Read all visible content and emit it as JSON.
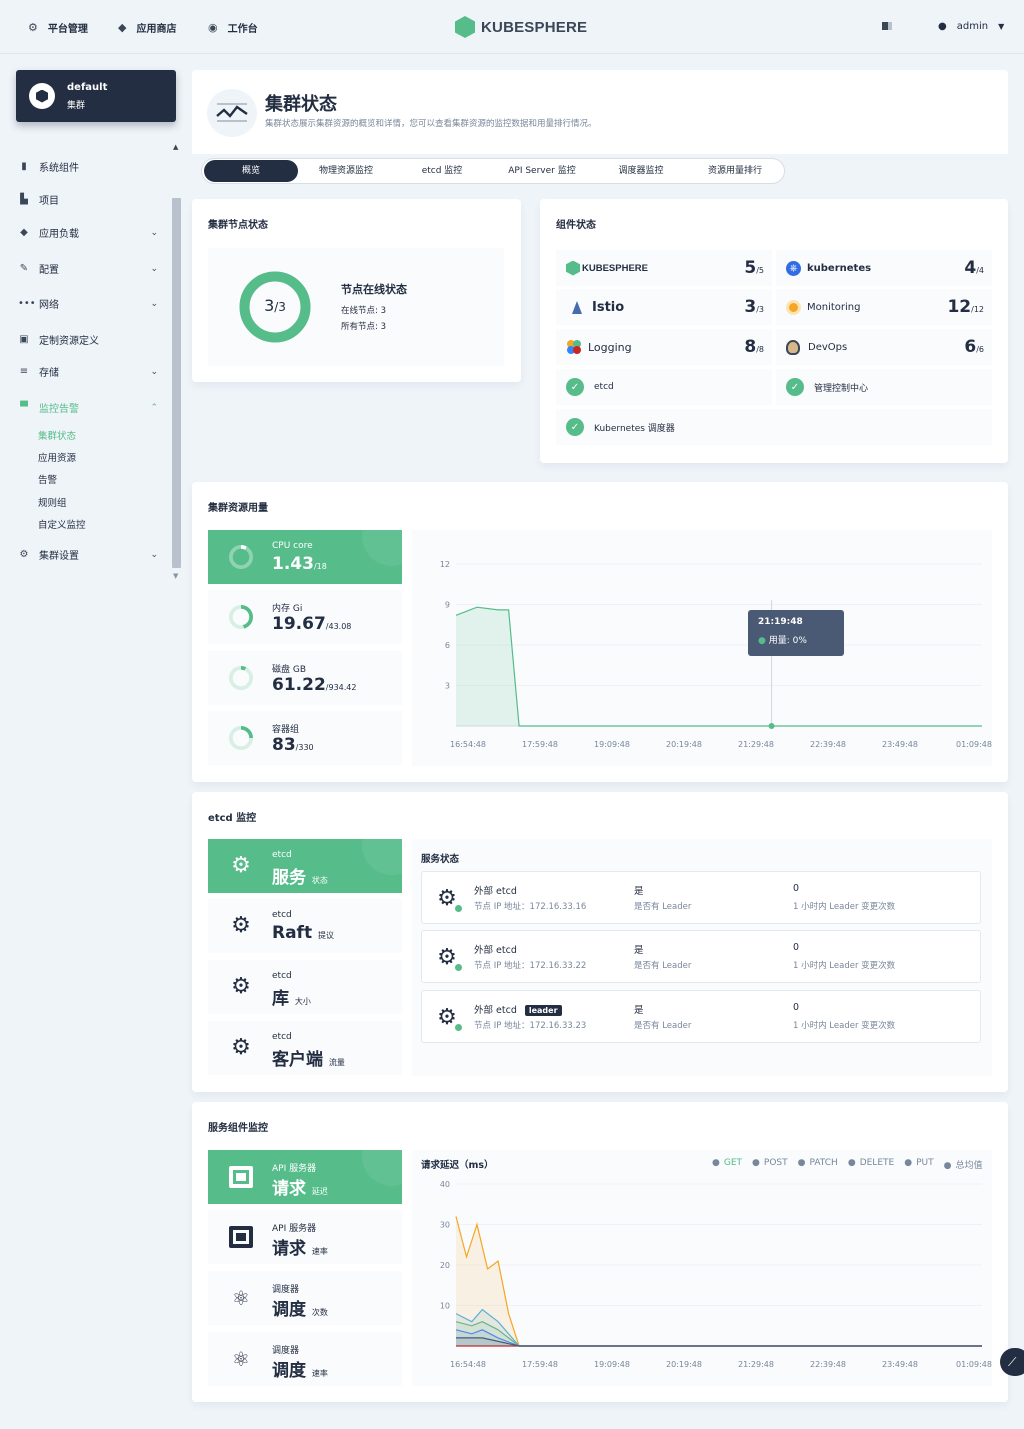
{
  "topbar": {
    "nav": [
      {
        "label": "平台管理",
        "icon": "gear-icon"
      },
      {
        "label": "应用商店",
        "icon": "app-store-icon"
      },
      {
        "label": "工作台",
        "icon": "workbench-icon"
      }
    ],
    "logo": "KUBESPHERE",
    "user": "admin"
  },
  "sidebar": {
    "cluster_name": "default",
    "cluster_label": "集群",
    "items": [
      {
        "label": "系统组件",
        "icon": "components-icon"
      },
      {
        "label": "项目",
        "icon": "project-icon"
      },
      {
        "label": "应用负载",
        "icon": "workload-icon",
        "expand": "chevron-down"
      },
      {
        "label": "配置",
        "icon": "config-icon",
        "expand": "chevron-down"
      },
      {
        "label": "网络",
        "icon": "network-icon",
        "expand": "chevron-down"
      },
      {
        "label": "定制资源定义",
        "icon": "crd-icon"
      },
      {
        "label": "存储",
        "icon": "storage-icon",
        "expand": "chevron-down"
      },
      {
        "label": "监控告警",
        "icon": "monitoring-icon",
        "expand": "chevron-up"
      },
      {
        "label": "集群设置",
        "icon": "settings-icon",
        "expand": "chevron-down"
      }
    ],
    "subitems": [
      "集群状态",
      "应用资源",
      "告警",
      "规则组",
      "自定义监控"
    ]
  },
  "header": {
    "title": "集群状态",
    "description": "集群状态展示集群资源的概览和详情，您可以查看集群资源的监控数据和用量排行情况。",
    "tabs": [
      "概览",
      "物理资源监控",
      "etcd 监控",
      "API Server 监控",
      "调度器监控",
      "资源用量排行"
    ]
  },
  "nodes": {
    "title": "集群节点状态",
    "ring_value": "3",
    "ring_total": "/3",
    "status_title": "节点在线状态",
    "online": "在线节点: 3",
    "total": "所有节点: 3",
    "fraction": 1.0
  },
  "components": {
    "title": "组件状态",
    "items": [
      {
        "name": "KUBESPHERE",
        "value": "5",
        "total": "/5"
      },
      {
        "name": "kubernetes",
        "value": "4",
        "total": "/4"
      },
      {
        "name": "Istio",
        "value": "3",
        "total": "/3"
      },
      {
        "name": "Monitoring",
        "value": "12",
        "total": "/12"
      },
      {
        "name": "Logging",
        "value": "8",
        "total": "/8"
      },
      {
        "name": "DevOps",
        "value": "6",
        "total": "/6"
      }
    ],
    "checks": [
      "etcd",
      "管理控制中心",
      "Kubernetes 调度器"
    ]
  },
  "resources": {
    "title": "集群资源用量",
    "tiles": [
      {
        "label": "CPU core",
        "value": "1.43",
        "total": "/18",
        "fraction": 0.08
      },
      {
        "label": "内存 Gi",
        "value": "19.67",
        "total": "/43.08",
        "fraction": 0.46
      },
      {
        "label": "磁盘 GB",
        "value": "61.22",
        "total": "/934.42",
        "fraction": 0.07
      },
      {
        "label": "容器组",
        "value": "83",
        "total": "/330",
        "fraction": 0.25
      }
    ],
    "tooltip_time": "21:19:48",
    "tooltip_value": "用量: 0%"
  },
  "chart_data": [
    {
      "type": "area",
      "title": "",
      "x": [
        "16:54:48",
        "17:59:48",
        "19:09:48",
        "20:19:48",
        "21:29:48",
        "22:39:48",
        "23:49:48",
        "01:09:48"
      ],
      "yticks": [
        3,
        6,
        9,
        12
      ],
      "ylim": [
        0,
        12
      ],
      "series": [
        {
          "values": [
            [
              0,
              8.2
            ],
            [
              0.04,
              8.8
            ],
            [
              0.08,
              8.6
            ],
            [
              0.1,
              8.6
            ],
            [
              0.12,
              0
            ],
            [
              1.0,
              0
            ]
          ]
        }
      ]
    },
    {
      "type": "area",
      "title": "请求延迟（ms）",
      "x": [
        "16:54:48",
        "17:59:48",
        "19:09:48",
        "20:19:48",
        "21:29:48",
        "22:39:48",
        "23:49:48",
        "01:09:48"
      ],
      "yticks": [
        10,
        20,
        30,
        40
      ],
      "ylim": [
        0,
        40
      ],
      "series": [
        {
          "name": "GET",
          "color": "#55bc8a",
          "values": [
            [
              0,
              6
            ],
            [
              0.03,
              5
            ],
            [
              0.05,
              6
            ],
            [
              0.08,
              4
            ],
            [
              0.12,
              0
            ],
            [
              1.0,
              0
            ]
          ]
        },
        {
          "name": "POST",
          "color": "#3385ff",
          "values": [
            [
              0,
              4
            ],
            [
              0.03,
              3
            ],
            [
              0.05,
              4
            ],
            [
              0.08,
              2
            ],
            [
              0.12,
              0
            ],
            [
              1.0,
              0
            ]
          ]
        },
        {
          "name": "PATCH",
          "color": "#f5a623",
          "values": [
            [
              0,
              32
            ],
            [
              0.02,
              22
            ],
            [
              0.04,
              30
            ],
            [
              0.06,
              19
            ],
            [
              0.08,
              21
            ],
            [
              0.1,
              8
            ],
            [
              0.12,
              0
            ],
            [
              1.0,
              0
            ]
          ]
        },
        {
          "name": "DELETE",
          "color": "#ca2621",
          "values": [
            [
              0,
              0
            ],
            [
              1.0,
              0
            ]
          ]
        },
        {
          "name": "PUT",
          "color": "#5eb0d4",
          "values": [
            [
              0,
              8
            ],
            [
              0.03,
              6
            ],
            [
              0.05,
              9
            ],
            [
              0.08,
              6
            ],
            [
              0.12,
              0
            ],
            [
              1.0,
              0
            ]
          ]
        },
        {
          "name": "总均值",
          "color": "#4a5974",
          "values": [
            [
              0,
              2
            ],
            [
              0.05,
              2
            ],
            [
              0.12,
              0
            ],
            [
              1.0,
              0
            ]
          ]
        }
      ]
    }
  ],
  "etcd": {
    "title": "etcd 监控",
    "tiles": [
      {
        "label": "etcd",
        "value": "服务",
        "unit": "状态"
      },
      {
        "label": "etcd",
        "value": "Raft",
        "unit": "提议"
      },
      {
        "label": "etcd",
        "value": "库",
        "unit": "大小"
      },
      {
        "label": "etcd",
        "value": "客户端",
        "unit": "流量"
      }
    ],
    "service_title": "服务状态",
    "rows": [
      {
        "name": "外部 etcd",
        "ip": "节点 IP 地址：172.16.33.16",
        "leader": "是",
        "leader_label": "是否有 Leader",
        "changes": "0",
        "changes_label": "1 小时内 Leader 变更次数",
        "badge": ""
      },
      {
        "name": "外部 etcd",
        "ip": "节点 IP 地址：172.16.33.22",
        "leader": "是",
        "leader_label": "是否有 Leader",
        "changes": "0",
        "changes_label": "1 小时内 Leader 变更次数",
        "badge": ""
      },
      {
        "name": "外部 etcd",
        "ip": "节点 IP 地址：172.16.33.23",
        "leader": "是",
        "leader_label": "是否有 Leader",
        "changes": "0",
        "changes_label": "1 小时内 Leader 变更次数",
        "badge": "leader"
      }
    ]
  },
  "services": {
    "title": "服务组件监控",
    "tiles": [
      {
        "label": "API 服务器",
        "value": "请求",
        "unit": "延迟"
      },
      {
        "label": "API 服务器",
        "value": "请求",
        "unit": "速率"
      },
      {
        "label": "调度器",
        "value": "调度",
        "unit": "次数"
      },
      {
        "label": "调度器",
        "value": "调度",
        "unit": "速率"
      }
    ]
  },
  "colors": {
    "accent": "#55bc8a",
    "dark": "#242e42",
    "background": "#eff4f9"
  }
}
